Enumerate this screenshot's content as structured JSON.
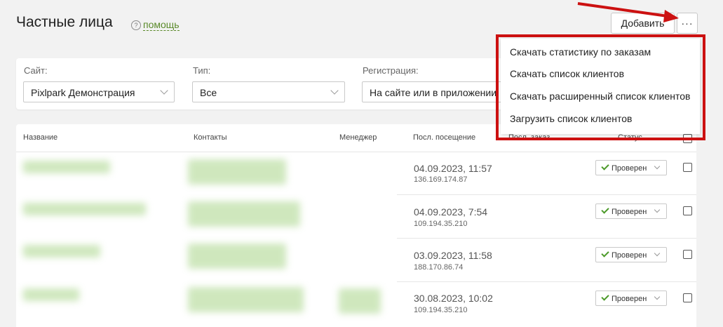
{
  "header": {
    "title": "Частные лица",
    "help_label": "помощь",
    "add_label": "Добавить",
    "more_label": "···"
  },
  "filters": [
    {
      "label": "Сайт:",
      "value": "Pixlpark Демонстрация"
    },
    {
      "label": "Тип:",
      "value": "Все"
    },
    {
      "label": "Регистрация:",
      "value": "На сайте или в приложении"
    }
  ],
  "table": {
    "columns": [
      "Название",
      "Контакты",
      "Менеджер",
      "Посл. посещение",
      "Посл. заказ",
      "Статус"
    ],
    "rows": [
      {
        "date": "04.09.2023, 11:57",
        "ip": "136.169.174.87",
        "status": "Проверен"
      },
      {
        "date": "04.09.2023, 7:54",
        "ip": "109.194.35.210",
        "status": "Проверен"
      },
      {
        "date": "03.09.2023, 11:58",
        "ip": "188.170.86.74",
        "status": "Проверен"
      },
      {
        "date": "30.08.2023, 10:02",
        "ip": "109.194.35.210",
        "status": "Проверен"
      }
    ]
  },
  "dropdown": {
    "items": [
      "Скачать статистику по заказам",
      "Скачать список клиентов",
      "Скачать расширенный список клиентов",
      "Загрузить список клиентов"
    ]
  },
  "colors": {
    "accent_green": "#4c9a2a",
    "highlight_red": "#cc1111"
  }
}
